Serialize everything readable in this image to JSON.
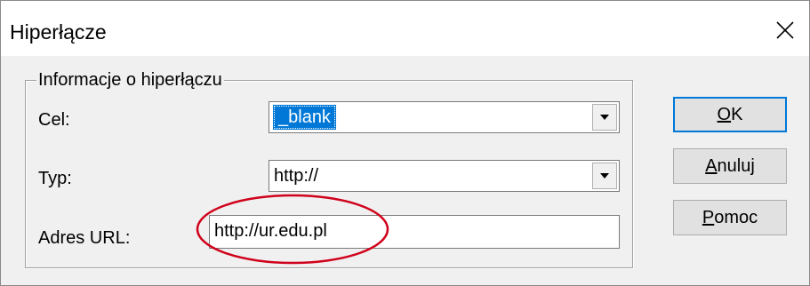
{
  "window": {
    "title": "Hiperłącze",
    "close_icon": "close-icon"
  },
  "group": {
    "legend": "Informacje o hiperłączu"
  },
  "fields": {
    "target": {
      "label": "Cel:",
      "value": "_blank"
    },
    "type": {
      "label": "Typ:",
      "value": "http://"
    },
    "url": {
      "label": "Adres URL:",
      "value": "http://ur.edu.pl"
    }
  },
  "buttons": {
    "ok": {
      "mnemonic": "O",
      "rest": "K"
    },
    "cancel": {
      "mnemonic": "A",
      "rest": "nuluj"
    },
    "help": {
      "mnemonic": "P",
      "rest": "omoc"
    }
  },
  "colors": {
    "selection": "#0078d7",
    "annotation": "#d0021b",
    "dialog_bg": "#f0f0f0"
  }
}
